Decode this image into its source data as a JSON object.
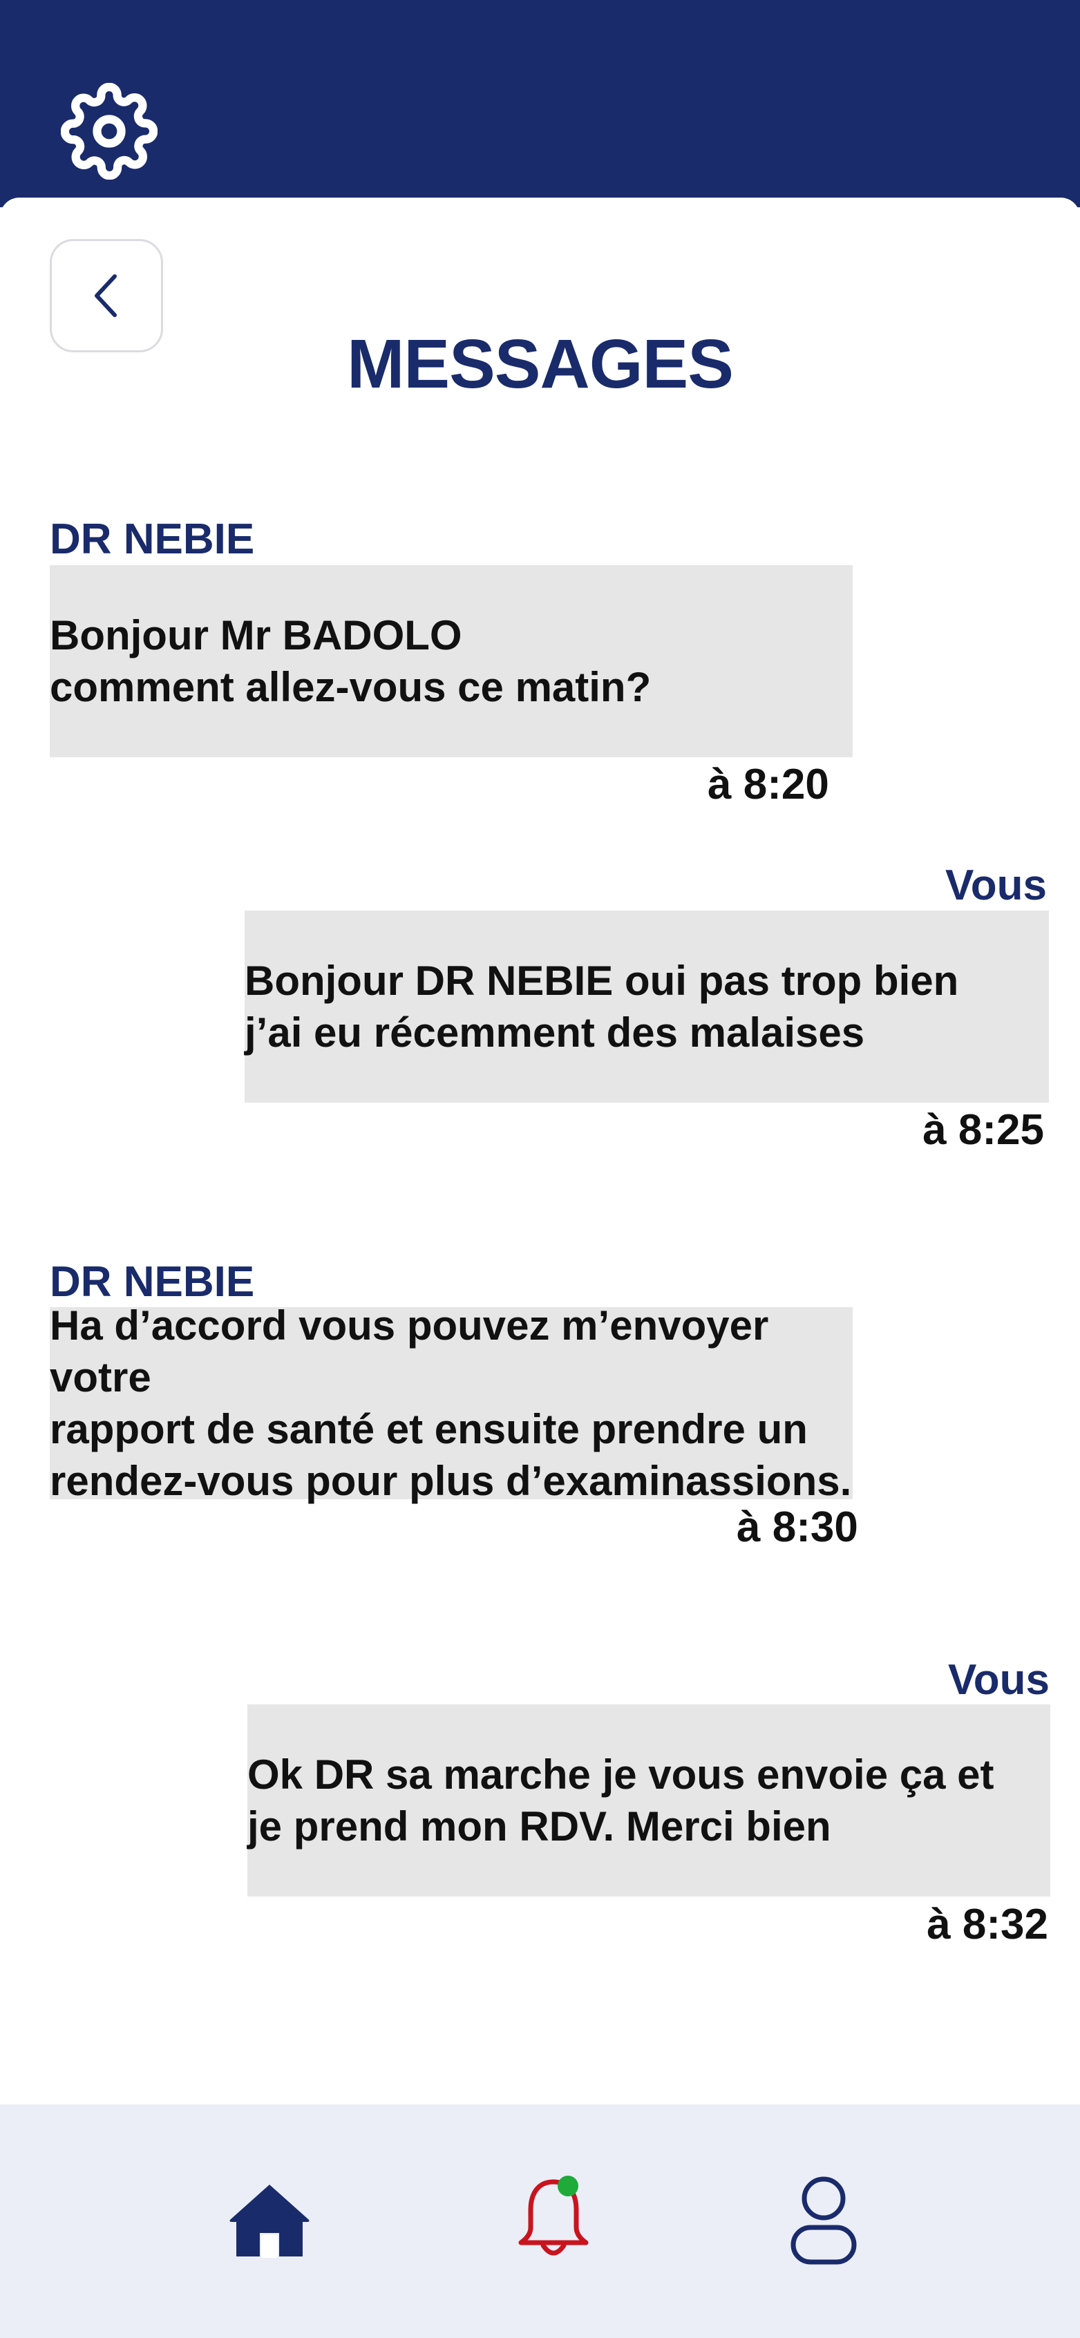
{
  "header": {
    "settings_icon": "gear-icon",
    "back_icon": "chevron-left-icon"
  },
  "page": {
    "title": "MESSAGES"
  },
  "messages": [
    {
      "sender": "DR NEBIE",
      "text": "Bonjour Mr BADOLO\ncomment allez-vous ce matin?",
      "time": "à 8:20",
      "side": "left"
    },
    {
      "sender": "Vous",
      "text": "Bonjour DR NEBIE  oui pas trop bien\n    j’ai eu récemment des malaises",
      "time": "à 8:25",
      "side": "right"
    },
    {
      "sender": "DR NEBIE",
      "text": "Ha d’accord vous pouvez m’envoyer votre\nrapport de santé et ensuite prendre un\nrendez-vous pour plus d’examinassions.",
      "time": "à 8:30",
      "side": "left"
    },
    {
      "sender": "Vous",
      "text": "Ok DR  sa marche je vous envoie ça et\nje prend mon RDV. Merci bien",
      "time": "à 8:32",
      "side": "right"
    }
  ],
  "bottom_nav": {
    "items": [
      {
        "icon": "home-icon"
      },
      {
        "icon": "bell-icon",
        "has_notification": true
      },
      {
        "icon": "user-icon"
      }
    ]
  },
  "colors": {
    "primary": "#1a2b6b",
    "bubble": "#e6e6e6",
    "bell": "#c8141e",
    "notification_dot": "#1faa3a",
    "nav_background": "#ebeef7"
  }
}
